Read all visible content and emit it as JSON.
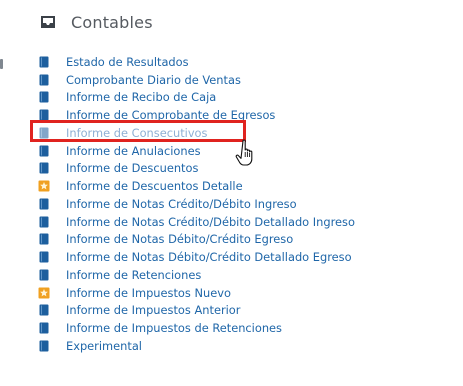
{
  "section": {
    "title": "Contables",
    "icon": "inbox-tray-icon"
  },
  "menu": {
    "items": [
      {
        "label": "Estado de Resultados",
        "icon": "report-book-icon"
      },
      {
        "label": "Comprobante Diario de Ventas",
        "icon": "report-book-icon"
      },
      {
        "label": "Informe de Recibo de Caja",
        "icon": "report-book-icon"
      },
      {
        "label": "Informe de Comprobante de Egresos",
        "icon": "report-book-icon"
      },
      {
        "label": "Informe de Consecutivos",
        "icon": "report-book-icon",
        "state": "highlighted"
      },
      {
        "label": "Informe de Anulaciones",
        "icon": "report-book-icon"
      },
      {
        "label": "Informe de Descuentos",
        "icon": "report-book-icon"
      },
      {
        "label": "Informe de Descuentos Detalle",
        "icon": "star-badge-icon"
      },
      {
        "label": "Informe de Notas Crédito/Débito Ingreso",
        "icon": "report-book-icon"
      },
      {
        "label": "Informe de Notas Crédito/Débito Detallado Ingreso",
        "icon": "report-book-icon"
      },
      {
        "label": "Informe de Notas Débito/Crédito Egreso",
        "icon": "report-book-icon"
      },
      {
        "label": "Informe de Notas Débito/Crédito Detallado Egreso",
        "icon": "report-book-icon"
      },
      {
        "label": "Informe de Retenciones",
        "icon": "report-book-icon"
      },
      {
        "label": "Informe de Impuestos Nuevo",
        "icon": "star-badge-icon"
      },
      {
        "label": "Informe de Impuestos Anterior",
        "icon": "report-book-icon"
      },
      {
        "label": "Informe de Impuestos de Retenciones",
        "icon": "report-book-icon"
      },
      {
        "label": "Experimental",
        "icon": "report-book-icon"
      }
    ]
  },
  "colors": {
    "link": "#1f66a8",
    "highlight_border": "#e0231f",
    "book_icon": "#1d5f9e",
    "star_icon": "#f0a020"
  }
}
